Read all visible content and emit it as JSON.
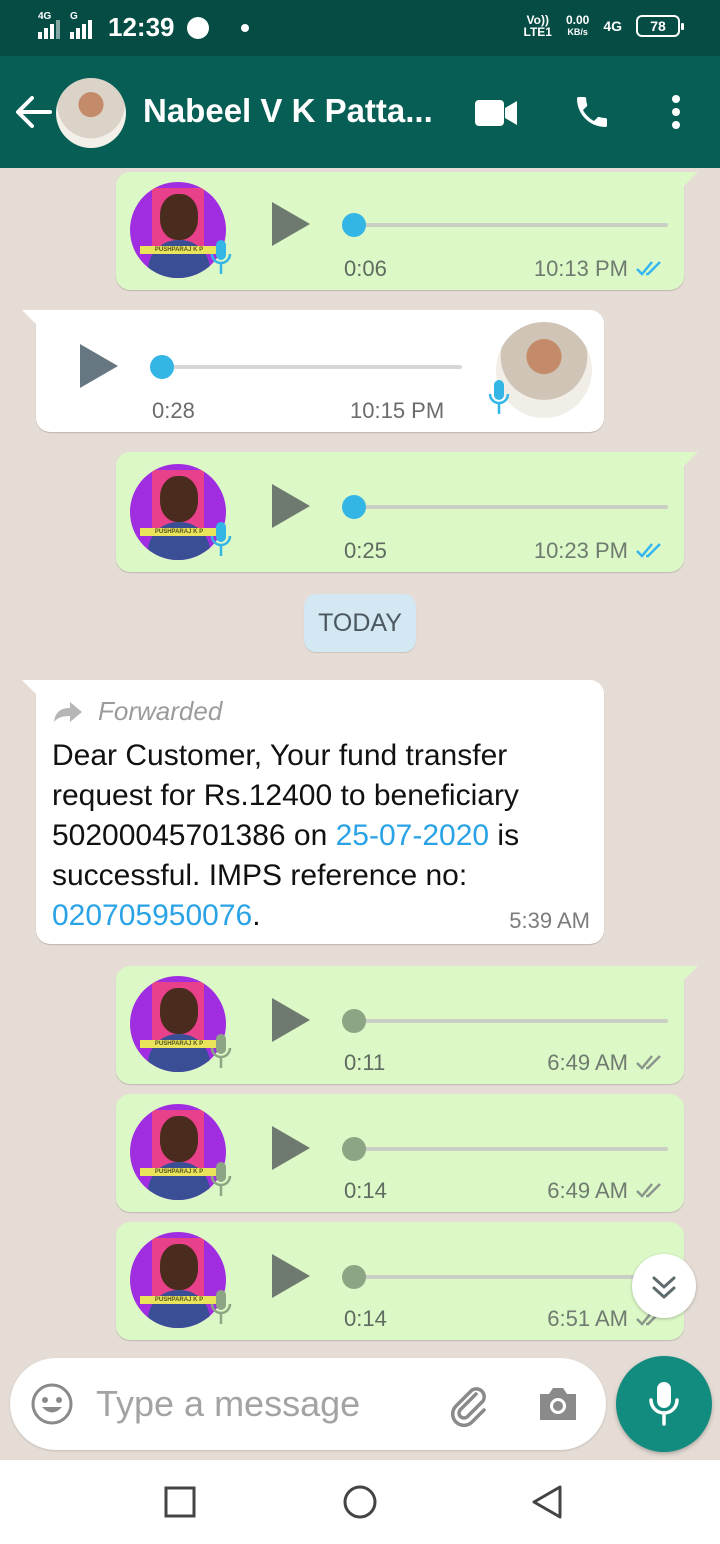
{
  "status_bar": {
    "sim1_label": "4G",
    "sim2_label": "G",
    "time": "12:39",
    "volte": "Vo))",
    "lte": "LTE1",
    "speed_value": "0.00",
    "speed_unit": "KB/s",
    "network": "4G",
    "battery": "78"
  },
  "header": {
    "contact_name": "Nabeel V K Patta...",
    "icons": [
      "back-arrow-icon",
      "video-call-icon",
      "phone-icon",
      "more-vert-icon"
    ]
  },
  "messages": [
    {
      "type": "voice",
      "direction": "outgoing",
      "duration": "0:06",
      "time": "10:13 PM",
      "status": "read",
      "avatar_band": "PUSHPARAJ K P"
    },
    {
      "type": "voice",
      "direction": "incoming",
      "duration": "0:28",
      "time": "10:15 PM"
    },
    {
      "type": "voice",
      "direction": "outgoing",
      "duration": "0:25",
      "time": "10:23 PM",
      "status": "read",
      "avatar_band": "PUSHPARAJ K P"
    },
    {
      "type": "date",
      "label": "TODAY"
    },
    {
      "type": "text",
      "direction": "incoming",
      "forwarded_label": "Forwarded",
      "text_parts": {
        "p1": "Dear Customer, Your fund transfer request for Rs.12400 to beneficiary 50200045701386 on ",
        "link_date": "25-07-2020",
        "p2": " is successful. IMPS reference no: ",
        "link_ref": "020705950076",
        "p3": "."
      },
      "time": "5:39 AM"
    },
    {
      "type": "voice",
      "direction": "outgoing",
      "duration": "0:11",
      "time": "6:49 AM",
      "status": "delivered",
      "avatar_band": "PUSHPARAJ K P"
    },
    {
      "type": "voice",
      "direction": "outgoing",
      "duration": "0:14",
      "time": "6:49 AM",
      "status": "delivered",
      "avatar_band": "PUSHPARAJ K P"
    },
    {
      "type": "voice",
      "direction": "outgoing",
      "duration": "0:14",
      "time": "6:51 AM",
      "status": "delivered",
      "avatar_band": "PUSHPARAJ K P"
    }
  ],
  "composer": {
    "placeholder": "Type a message",
    "icons": [
      "emoji-icon",
      "attach-icon",
      "camera-icon",
      "mic-icon"
    ]
  },
  "colors": {
    "header": "#075e54",
    "status_bar": "#054d44",
    "outgoing_bubble": "#dcf8c6",
    "incoming_bubble": "#ffffff",
    "read_ticks": "#34b7f1",
    "link": "#2aa3e6",
    "fab": "#128c7e"
  },
  "nav_bar": {
    "icons": [
      "recents-square-icon",
      "home-circle-icon",
      "back-triangle-icon"
    ]
  }
}
